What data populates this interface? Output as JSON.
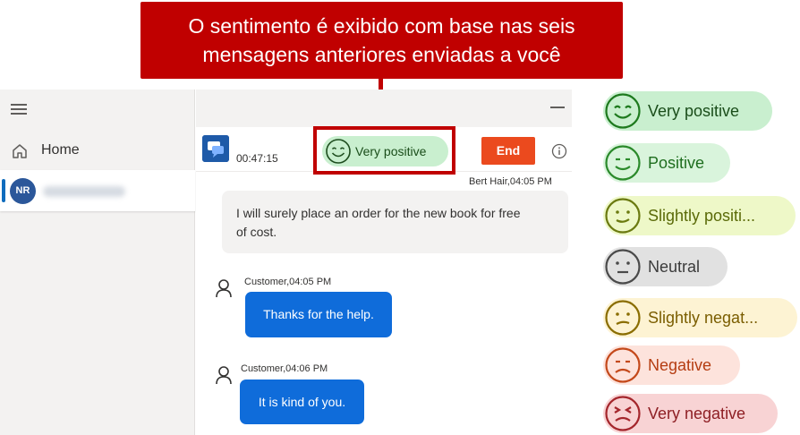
{
  "callout": {
    "line1": "O sentimento é exibido com base nas seis",
    "line2": "mensagens anteriores enviadas a você"
  },
  "sidebar": {
    "home_label": "Home",
    "session_initials": "NR"
  },
  "header": {
    "timer": "00:47:15",
    "sentiment_label": "Very positive",
    "end_label": "End"
  },
  "messages": [
    {
      "sender": "Bert Hair,04:05 PM",
      "text_line1": "I will surely place an order for the new book for free",
      "text_line2": "of cost."
    },
    {
      "sender": "Customer,04:05 PM",
      "text": "Thanks for the help."
    },
    {
      "sender": "Customer,04:06 PM",
      "text": "It is kind of you."
    }
  ],
  "legend": [
    {
      "label": "Very positive",
      "color": "#1e7a1e",
      "bg": "#c9efcf"
    },
    {
      "label": "Positive",
      "color": "#2b8a2b",
      "bg": "#d9f4dc"
    },
    {
      "label": "Slightly positi...",
      "color": "#6b7a10",
      "bg": "#eef8c8"
    },
    {
      "label": "Neutral",
      "color": "#4a4a4a",
      "bg": "#e1e1e1"
    },
    {
      "label": "Slightly negat...",
      "color": "#8a6d00",
      "bg": "#fdf3d3"
    },
    {
      "label": "Negative",
      "color": "#c4491b",
      "bg": "#fde3dc"
    },
    {
      "label": "Very negative",
      "color": "#a4262c",
      "bg": "#f8d3d4"
    }
  ]
}
